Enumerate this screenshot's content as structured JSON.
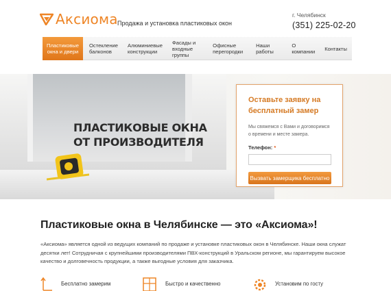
{
  "header": {
    "logo_text": "Аксиома",
    "tagline": "Продажа и установка пластиковых окон",
    "city": "г. Челябинск",
    "phone": "(351) 225-02-20"
  },
  "nav": {
    "items": [
      {
        "line1": "Пластиковые",
        "line2": "окна и двери"
      },
      {
        "line1": "Остекление",
        "line2": "балконов"
      },
      {
        "line1": "Алюминиевые",
        "line2": "конструкции"
      },
      {
        "line1": "Фасады и",
        "line2": "входные группы"
      },
      {
        "line1": "Офисные",
        "line2": "перегородки"
      },
      {
        "line1": "Наши работы",
        "line2": ""
      },
      {
        "line1": "О компании",
        "line2": ""
      },
      {
        "line1": "Контакты",
        "line2": ""
      }
    ]
  },
  "hero": {
    "title_line1": "ПЛАСТИКОВЫЕ ОКНА",
    "title_line2": "ОТ ПРОИЗВОДИТЕЛЯ"
  },
  "form": {
    "title_line1": "Оставьте заявку на",
    "title_line2": "бесплатный замер",
    "desc": "Мы свяжемся с Вами и договоримся о времени и месте замера.",
    "phone_label": "Телефон:",
    "required_mark": "*",
    "phone_value": "",
    "button_label": "Вызвать замерщика бесплатно"
  },
  "main": {
    "title": "Пластиковые окна в Челябинске — это «Аксиома»!",
    "text": "«Аксиома» является одной из ведущих компаний по продаже и установке пластиковых окон в Челябинске. Наши окна служат десятки лет! Сотрудничая с крупнейшими производителями ПВХ-конструкций в Уральском регионе, мы гарантируем высокое качество и долговечность продукции, а также выгодные условия для заказчика."
  },
  "features": [
    {
      "icon": "ruler-arrow-icon",
      "label": "Бесплатно замерим"
    },
    {
      "icon": "window-icon",
      "label": "Быстро и качественно"
    },
    {
      "icon": "gear-certificate-icon",
      "label": "Установим по госту"
    }
  ],
  "colors": {
    "accent": "#ee8526",
    "accent_dark": "#d57a24"
  }
}
